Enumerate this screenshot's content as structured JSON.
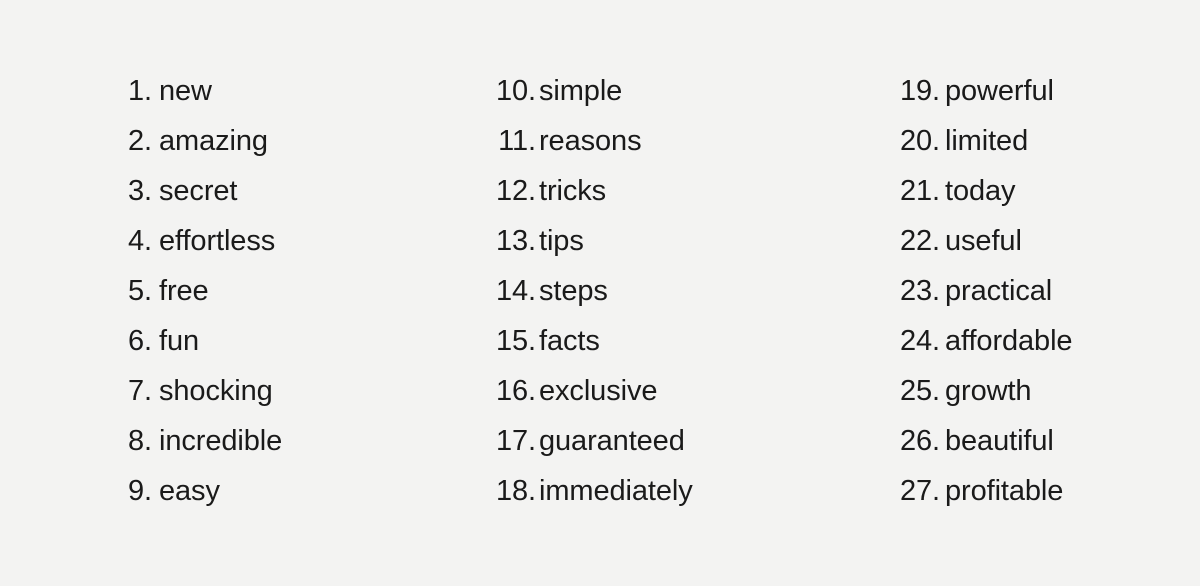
{
  "document": {
    "type": "numbered-word-list",
    "background_color": "#f3f3f2",
    "text_color": "#1a1a1a",
    "total_items": 27,
    "column_count": 3
  },
  "columns": [
    {
      "id": "column-1",
      "items": [
        {
          "number": "1.",
          "word": "new"
        },
        {
          "number": "2.",
          "word": "amazing"
        },
        {
          "number": "3.",
          "word": "secret"
        },
        {
          "number": "4.",
          "word": "effortless"
        },
        {
          "number": "5.",
          "word": "free"
        },
        {
          "number": "6.",
          "word": "fun"
        },
        {
          "number": "7.",
          "word": "shocking"
        },
        {
          "number": "8.",
          "word": "incredible"
        },
        {
          "number": "9.",
          "word": "easy"
        }
      ]
    },
    {
      "id": "column-2",
      "items": [
        {
          "number": "10.",
          "word": "simple"
        },
        {
          "number": "11.",
          "word": "reasons"
        },
        {
          "number": "12.",
          "word": "tricks"
        },
        {
          "number": "13.",
          "word": "tips"
        },
        {
          "number": "14.",
          "word": "steps"
        },
        {
          "number": "15.",
          "word": "facts"
        },
        {
          "number": "16.",
          "word": "exclusive"
        },
        {
          "number": "17.",
          "word": "guaranteed"
        },
        {
          "number": "18.",
          "word": "immediately"
        }
      ]
    },
    {
      "id": "column-3",
      "items": [
        {
          "number": "19.",
          "word": "powerful"
        },
        {
          "number": "20.",
          "word": "limited"
        },
        {
          "number": "21.",
          "word": "today"
        },
        {
          "number": "22.",
          "word": "useful"
        },
        {
          "number": "23.",
          "word": "practical"
        },
        {
          "number": "24.",
          "word": "affordable"
        },
        {
          "number": "25.",
          "word": "growth"
        },
        {
          "number": "26.",
          "word": "beautiful"
        },
        {
          "number": "27.",
          "word": "profitable"
        }
      ]
    }
  ]
}
